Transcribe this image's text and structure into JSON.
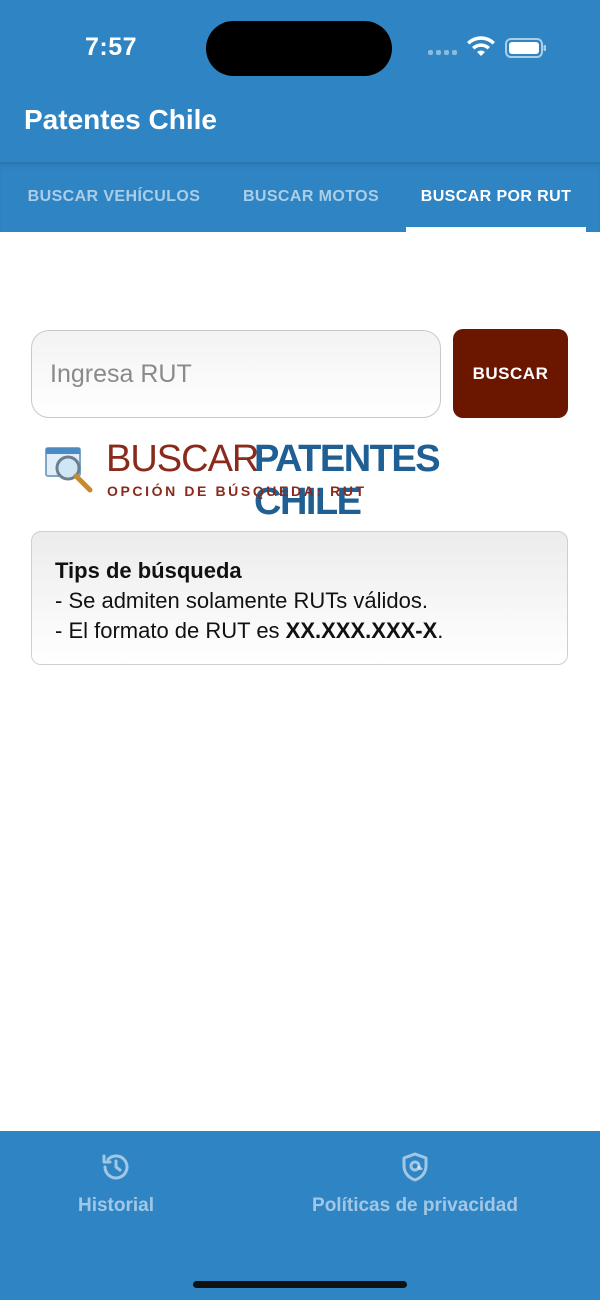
{
  "status_bar": {
    "time": "7:57"
  },
  "app": {
    "title": "Patentes Chile"
  },
  "tabs": [
    {
      "label": "BUSCAR VEHÍCULOS",
      "active": false
    },
    {
      "label": "BUSCAR MOTOS",
      "active": false
    },
    {
      "label": "BUSCAR POR RUT",
      "active": true
    }
  ],
  "search": {
    "placeholder": "Ingresa RUT",
    "value": "",
    "button_label": "BUSCAR"
  },
  "logo": {
    "word1": "BUSCAR",
    "word2": "PATENTES CHILE",
    "subtitle": "OPCIÓN DE BÚSQUEDA: RUT"
  },
  "tips": {
    "title": "Tips de búsqueda",
    "line1": "- Se admiten solamente RUTs válidos.",
    "line2_prefix": "- El formato de RUT es ",
    "line2_format": "XX.XXX.XXX-X",
    "line2_suffix": "."
  },
  "bottom_nav": [
    {
      "label": "Historial",
      "icon": "history-icon"
    },
    {
      "label": "Políticas de privacidad",
      "icon": "privacy-shield-icon"
    }
  ],
  "colors": {
    "primary": "#2f84c3",
    "button": "#6b1700",
    "logo_red": "#8a2a1a",
    "logo_blue": "#1f5f93"
  }
}
